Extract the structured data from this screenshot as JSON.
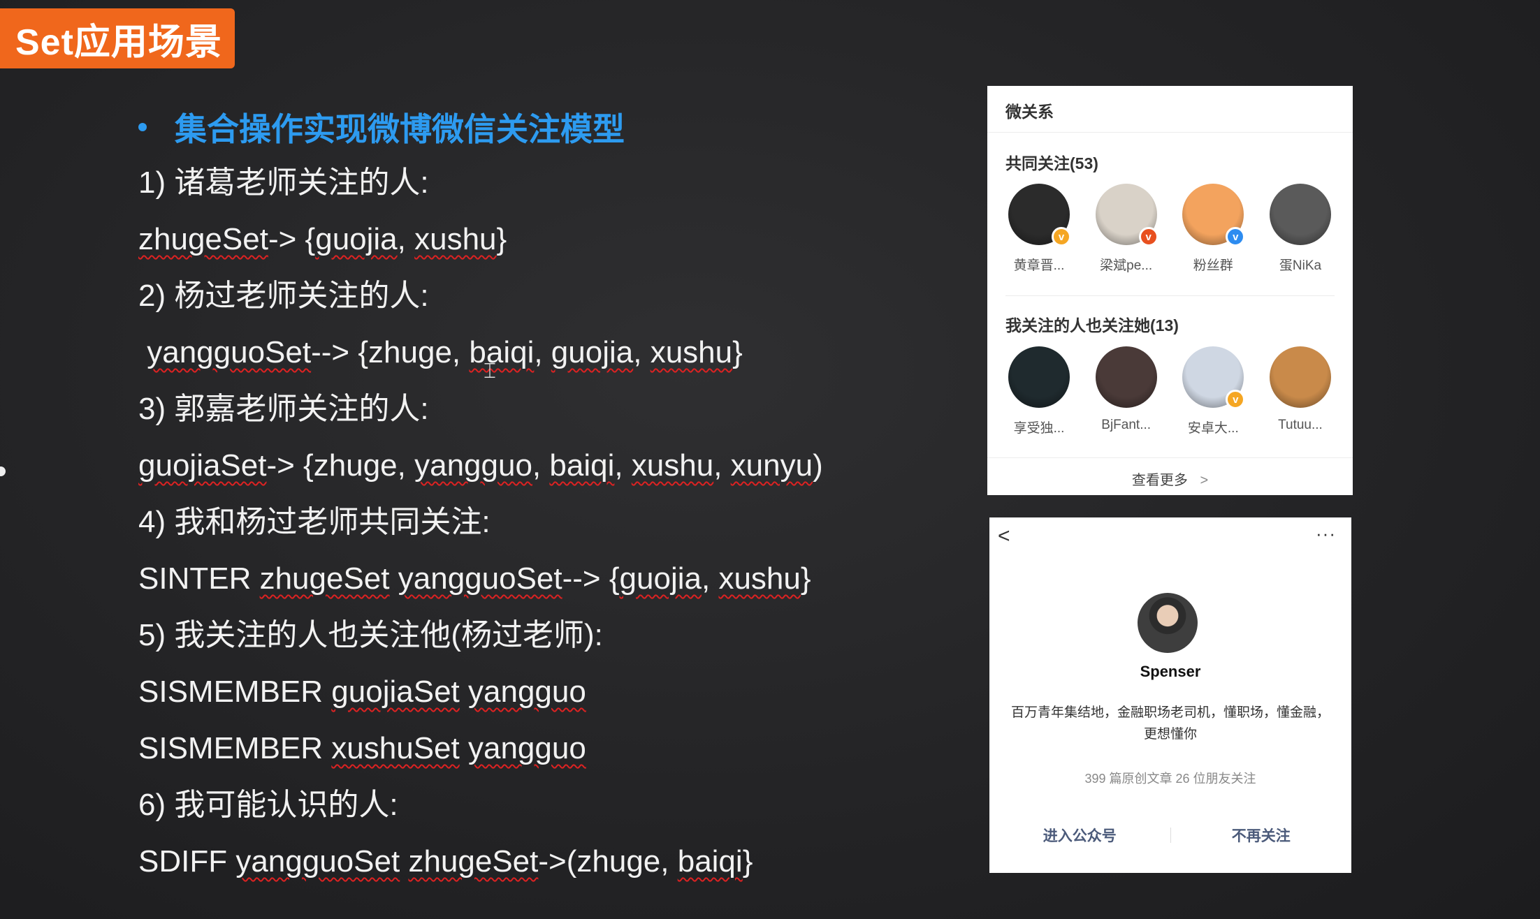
{
  "slide": {
    "title": "Set应用场景",
    "bullet": "集合操作实现微博微信关注模型",
    "lines": [
      {
        "plain": "1) 诸葛老师关注的人:"
      },
      {
        "code": [
          "zhugeSet",
          "-> {",
          "guojia",
          ", ",
          "xushu",
          "}"
        ]
      },
      {
        "plain": "2) 杨过老师关注的人:"
      },
      {
        "code": [
          " ",
          "yangguoSet",
          "--> {zhuge, ",
          "baiqi",
          ", ",
          "guojia",
          ", ",
          "xushu",
          "}"
        ]
      },
      {
        "plain": "3) 郭嘉老师关注的人:"
      },
      {
        "code": [
          "guojiaSet",
          "-> {zhuge, ",
          "yangguo",
          ", ",
          "baiqi",
          ", ",
          "xushu",
          ", ",
          "xunyu",
          ")"
        ]
      },
      {
        "plain": "4) 我和杨过老师共同关注:"
      },
      {
        "code": [
          "SINTER ",
          "zhugeSet",
          " ",
          "yangguoSet",
          "--> {",
          "guojia",
          ", ",
          "xushu",
          "}"
        ]
      },
      {
        "plain": "5) 我关注的人也关注他(杨过老师):"
      },
      {
        "code": [
          "SISMEMBER ",
          "guojiaSet",
          " ",
          "yangguo",
          ""
        ]
      },
      {
        "code": [
          "SISMEMBER ",
          "xushuSet",
          " ",
          "yangguo",
          ""
        ]
      },
      {
        "plain": "6) 我可能认识的人:"
      },
      {
        "code": [
          "SDIFF ",
          "yangguoSet",
          " ",
          "zhugeSet",
          "->(zhuge, ",
          "baiqi",
          "}"
        ]
      }
    ]
  },
  "weibo_panel": {
    "title": "微关系",
    "common_follow": {
      "title": "共同关注(53)",
      "items": [
        {
          "name": "黄章晋...",
          "badge": "v",
          "badge_color": "#f5a623",
          "bg": "#2b2b2b"
        },
        {
          "name": "梁斌pe...",
          "badge": "v",
          "badge_color": "#e8501f",
          "bg": "#d9d2c8"
        },
        {
          "name": "粉丝群",
          "badge": "v",
          "badge_color": "#2d8cf0",
          "bg": "#f3a35e"
        },
        {
          "name": "蛋NiKa",
          "badge": "",
          "badge_color": "",
          "bg": "#5a5a5a"
        }
      ]
    },
    "also_follow": {
      "title": "我关注的人也关注她(13)",
      "items": [
        {
          "name": "享受独...",
          "badge": "",
          "badge_color": "",
          "bg": "#1f2a2e"
        },
        {
          "name": "BjFant...",
          "badge": "",
          "badge_color": "",
          "bg": "#4a3a38"
        },
        {
          "name": "安卓大...",
          "badge": "v",
          "badge_color": "#f5a623",
          "bg": "#cfd7e3"
        },
        {
          "name": "Tutuu...",
          "badge": "",
          "badge_color": "",
          "bg": "#c98a4a"
        }
      ]
    },
    "more_label": "查看更多",
    "more_chevron": ">"
  },
  "wechat_panel": {
    "back_icon": "<",
    "more_icon": "···",
    "name": "Spenser",
    "bio": "百万青年集结地，金融职场老司机，懂职场，懂金融，更想懂你",
    "stats": "399 篇原创文章  26 位朋友关注",
    "enter_label": "进入公众号",
    "unfollow_label": "不再关注"
  }
}
